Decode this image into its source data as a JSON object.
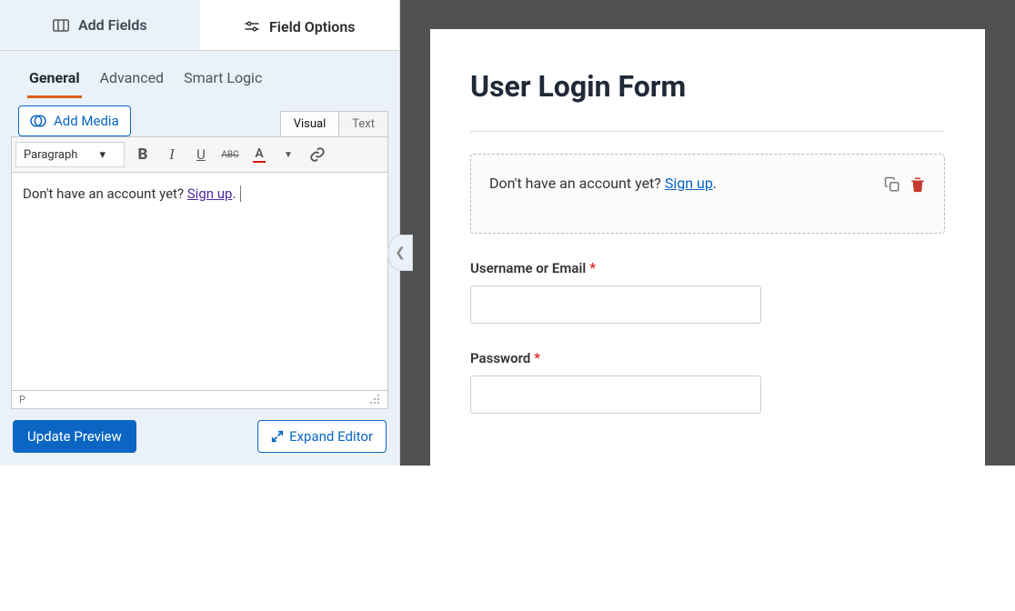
{
  "tabs": {
    "add_fields": "Add Fields",
    "field_options": "Field Options"
  },
  "sub_tabs": {
    "general": "General",
    "advanced": "Advanced",
    "smart": "Smart Logic"
  },
  "editor": {
    "add_media": "Add Media",
    "visual_tab": "Visual",
    "text_tab": "Text",
    "format_label": "Paragraph",
    "content_prefix": "Don't have an account yet? ",
    "content_link": "Sign up",
    "content_suffix": ".",
    "path": "P"
  },
  "buttons": {
    "update": "Update Preview",
    "expand": "Expand Editor"
  },
  "preview": {
    "title": "User Login Form",
    "html_prefix": "Don't have an account yet? ",
    "html_link": "Sign up",
    "html_suffix": ".",
    "field1_label": "Username or Email",
    "field2_label": "Password",
    "required": "*"
  }
}
